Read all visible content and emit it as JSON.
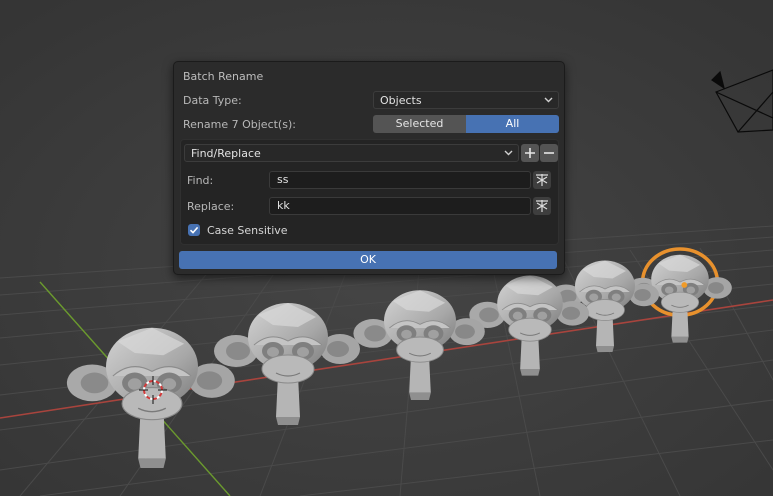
{
  "dialog": {
    "title": "Batch Rename",
    "data_type_label": "Data Type:",
    "data_type_value": "Objects",
    "rename_label": "Rename 7 Object(s):",
    "scope_options": [
      "Selected",
      "All"
    ],
    "scope_selected": "All",
    "operation": {
      "type": "Find/Replace",
      "find_label": "Find:",
      "find_value": "ss",
      "replace_label": "Replace:",
      "replace_value": "kk",
      "case_sensitive_label": "Case Sensitive",
      "case_sensitive": true
    },
    "ok_label": "OK"
  },
  "colors": {
    "accent": "#4772b3",
    "panel_bg": "#2b2b2b",
    "viewport_bg": "#3d3d3d",
    "selection_outline": "#e8912d",
    "active_orange": "#f09b29",
    "x_axis": "#b0403a",
    "y_axis": "#6d9a2e"
  },
  "scene": {
    "objects": [
      "monkey-mesh",
      "monkey-mesh",
      "monkey-mesh",
      "monkey-mesh",
      "monkey-mesh",
      "monkey-mesh"
    ],
    "active_object_highlight": true,
    "camera_visible": true
  }
}
